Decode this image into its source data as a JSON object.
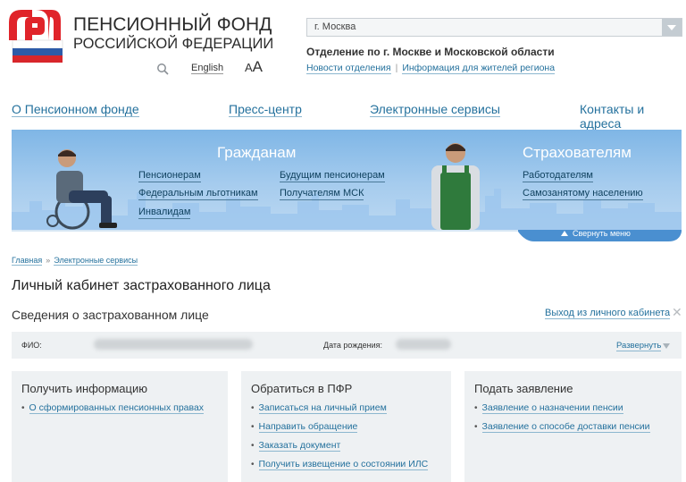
{
  "header": {
    "org_line1": "ПЕНСИОННЫЙ ФОНД",
    "org_line2": "РОССИЙСКОЙ ФЕДЕРАЦИИ",
    "lang_label": "English",
    "font_size_label_small": "A",
    "font_size_label_large": "A",
    "region": {
      "value": "г. Москва",
      "branch_title": "Отделение по г. Москве и Московской области",
      "links": [
        "Новости отделения",
        "Информация для жителей региона"
      ],
      "separator": "|"
    }
  },
  "main_nav": [
    "О Пенсионном фонде",
    "Пресс-центр",
    "Электронные сервисы",
    "Контакты и адреса"
  ],
  "banner": {
    "citizens": {
      "title": "Гражданам",
      "links": [
        "Пенсионерам",
        "Федеральным льготникам",
        "Инвалидам",
        "Будущим пенсионерам",
        "Получателям МСК"
      ]
    },
    "insurers": {
      "title": "Страхователям",
      "links": [
        "Работодателям",
        "Самозанятому населению"
      ]
    },
    "collapse_label": "Свернуть меню"
  },
  "breadcrumb": {
    "items": [
      "Главная",
      "Электронные сервисы"
    ],
    "separator": "»"
  },
  "page_title": "Личный кабинет застрахованного лица",
  "section": {
    "title": "Сведения о застрахованном лице",
    "logout": "Выход из личного кабинета",
    "close": "✕"
  },
  "info_bar": {
    "fio_label": "ФИО:",
    "dob_label": "Дата рождения:",
    "expand_label": "Развернуть"
  },
  "cards": [
    {
      "title": "Получить информацию",
      "links": [
        "О сформированных пенсионных правах"
      ]
    },
    {
      "title": "Обратиться в ПФР",
      "links": [
        "Записаться на личный прием",
        "Направить обращение",
        "Заказать документ",
        "Получить извещение о состоянии ИЛС"
      ]
    },
    {
      "title": "Подать заявление",
      "links": [
        "Заявление о назначении пенсии",
        "Заявление о способе доставки пенсии"
      ]
    }
  ],
  "colors": {
    "link": "#24719d",
    "banner_blue": "#7fb6e6",
    "logo_red": "#e0242a",
    "panel_bg": "#eef1f3"
  }
}
